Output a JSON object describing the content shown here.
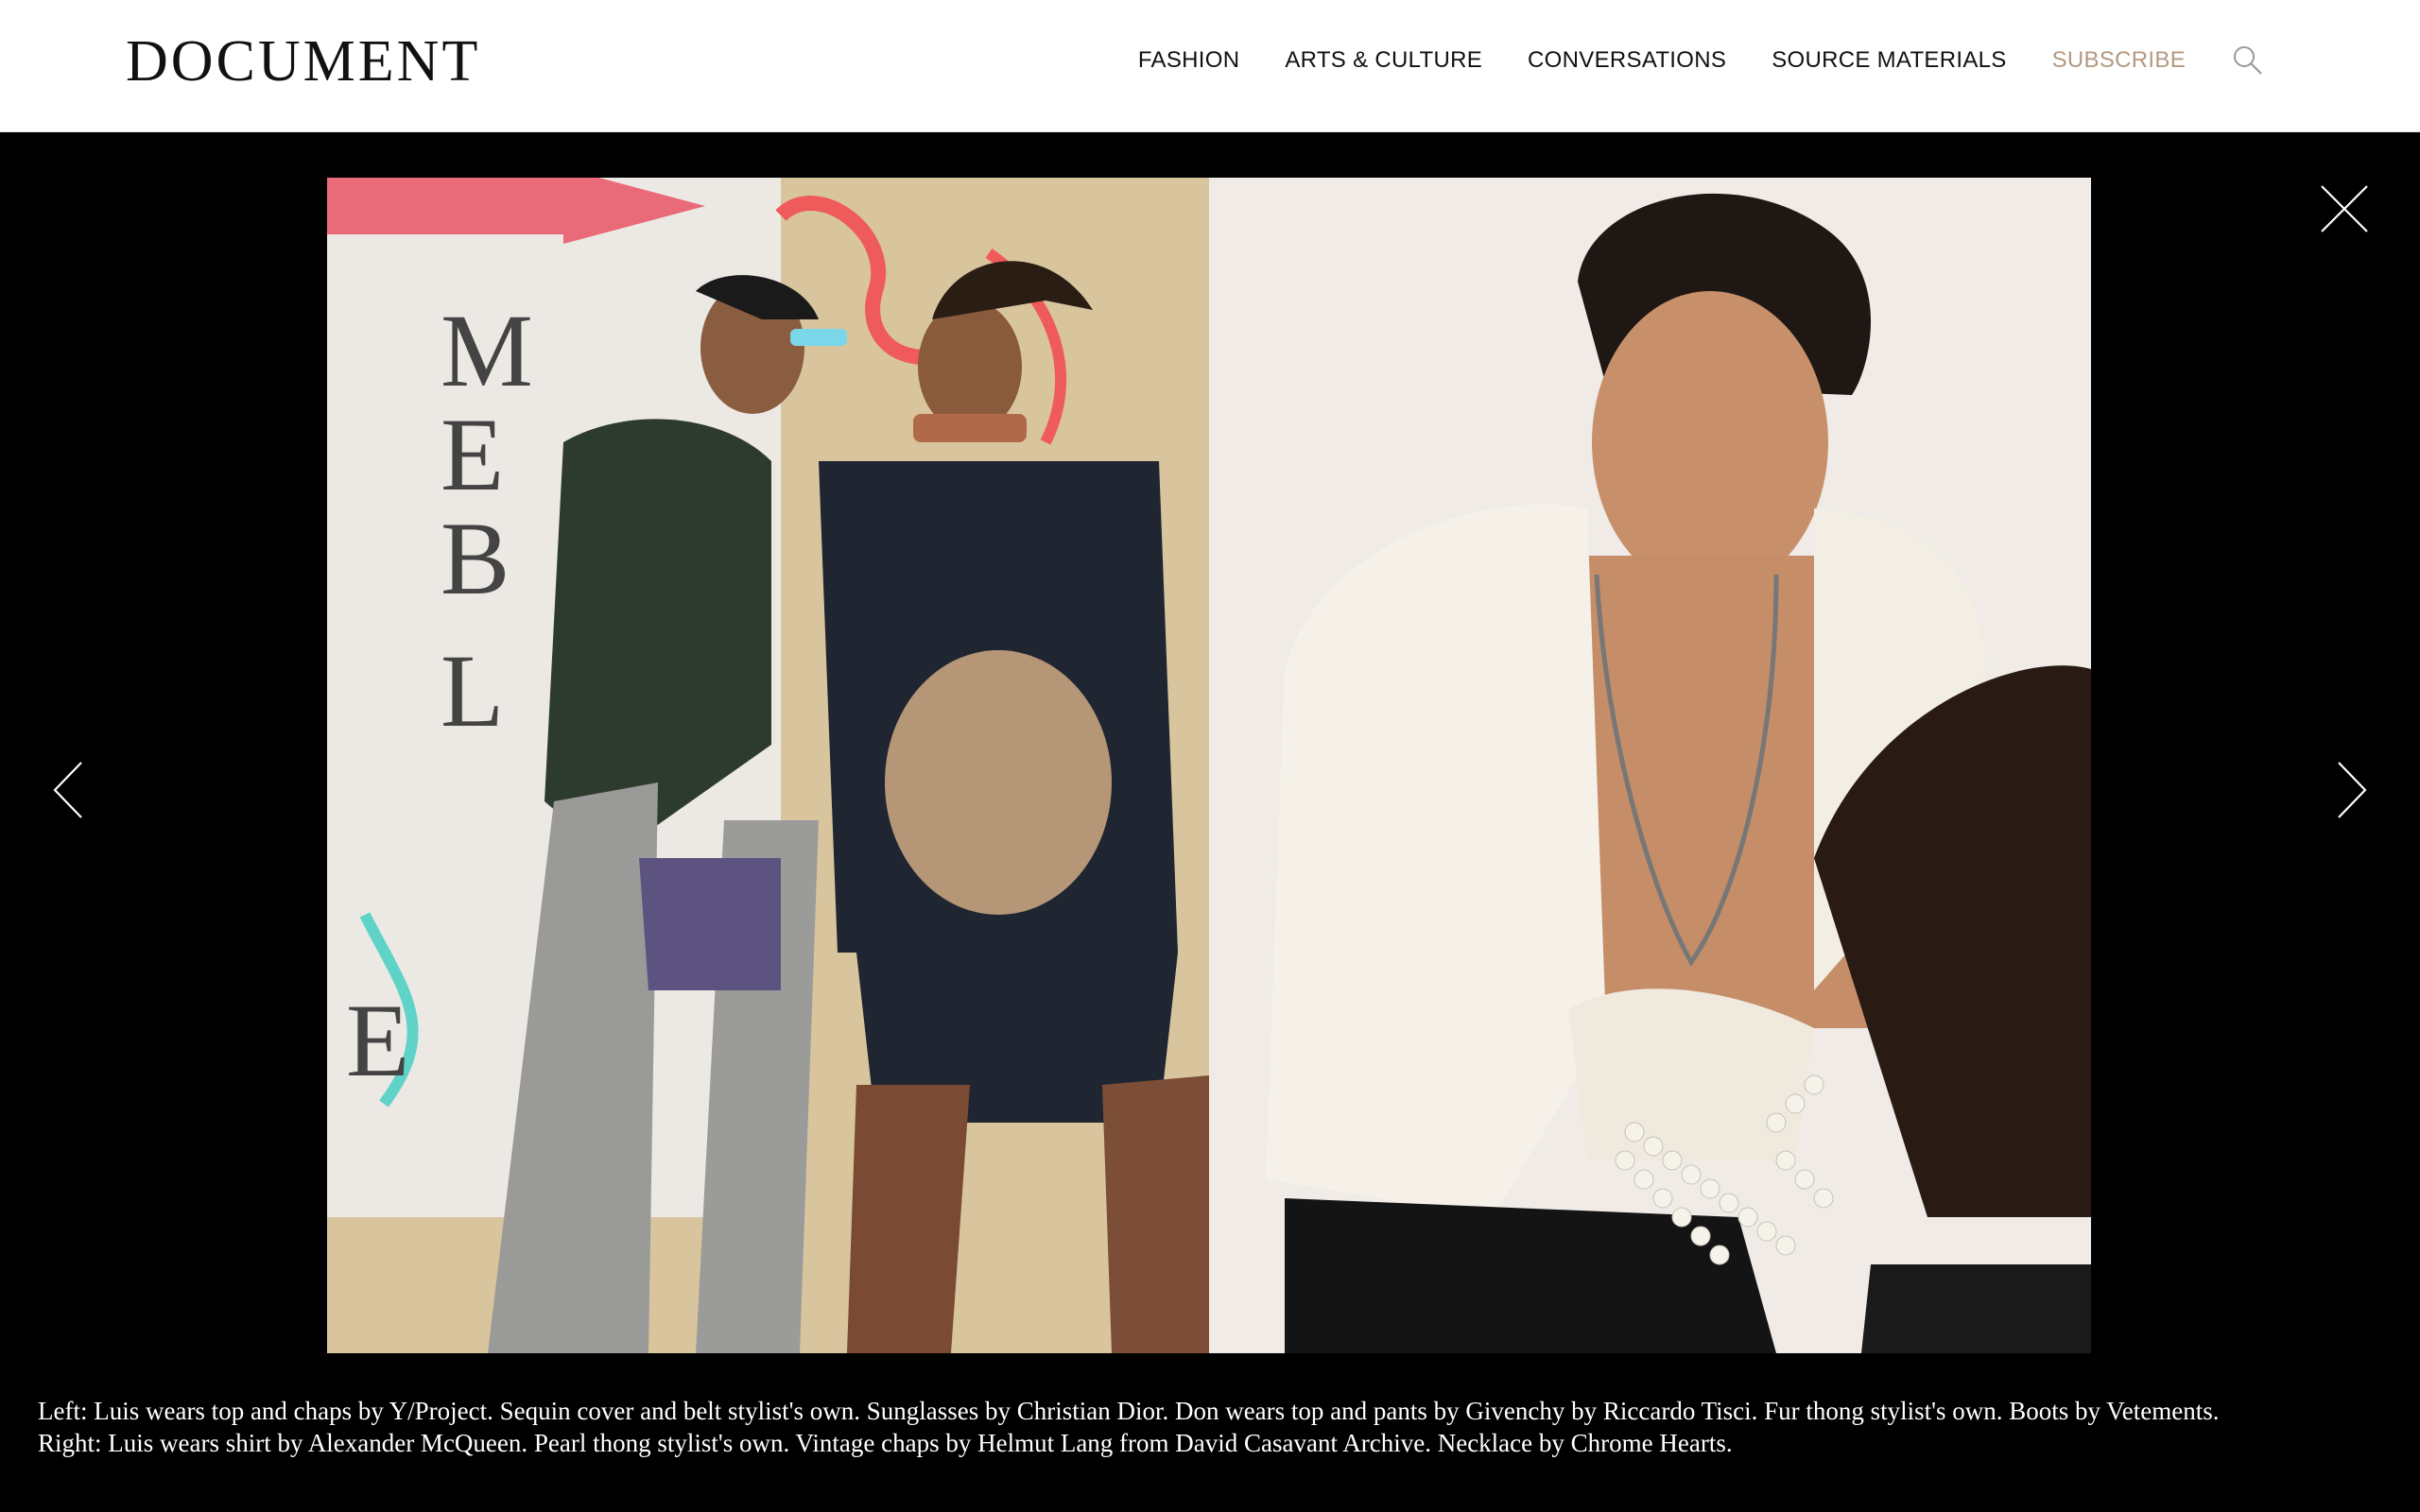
{
  "header": {
    "logo": "DOCUMENT",
    "nav": [
      {
        "label": "FASHION"
      },
      {
        "label": "ARTS & CULTURE"
      },
      {
        "label": "CONVERSATIONS"
      },
      {
        "label": "SOURCE MATERIALS"
      },
      {
        "label": "SUBSCRIBE"
      }
    ],
    "search_icon": "search-icon"
  },
  "lightbox": {
    "close_icon": "close-icon",
    "prev_icon": "chevron-left-icon",
    "next_icon": "chevron-right-icon",
    "images": [
      {
        "name": "left-photo"
      },
      {
        "name": "right-photo"
      }
    ],
    "caption": {
      "line1": "Left: Luis wears top and chaps by Y/Project. Sequin cover and belt stylist's own. Sunglasses by Christian Dior. Don wears top and pants by Givenchy by Riccardo Tisci. Fur thong stylist's own. Boots by Vetements.",
      "line2": "Right: Luis wears shirt by Alexander McQueen. Pearl thong stylist's own. Vintage chaps by Helmut Lang from David Casavant Archive. Necklace by Chrome Hearts."
    }
  },
  "colors": {
    "header_bg": "#ffffff",
    "lightbox_bg": "#000000",
    "subscribe_accent": "#b39a80",
    "nav_text": "#111111",
    "caption_text": "#ffffff"
  }
}
